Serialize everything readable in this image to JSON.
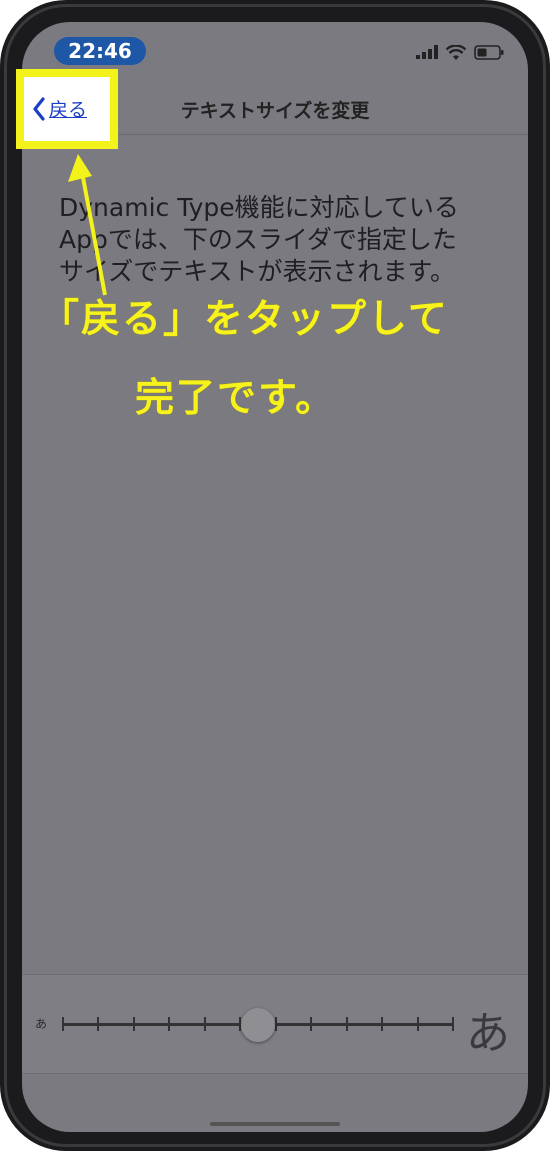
{
  "status_bar": {
    "time": "22:46",
    "icons": [
      "cellular-signal-icon",
      "wifi-icon",
      "battery-icon"
    ]
  },
  "nav": {
    "back_label": "戻る",
    "title": "テキストサイズを変更"
  },
  "content": {
    "description_lines": [
      "Dynamic Type機能に対応している",
      "Appでは、下のスライダで指定した",
      "サイズでテキストが表示されます。"
    ]
  },
  "annotation": {
    "caption_line1": "「戻る」をタップして",
    "caption_line2": "完了です。",
    "highlight_color": "#f4f21b"
  },
  "slider": {
    "min_label": "あ",
    "max_label": "あ",
    "tick_count": 12,
    "value_fraction": 0.5
  },
  "colors": {
    "screen_dim": "#7b7a80",
    "link_blue": "#1b3ec7",
    "time_pill": "#1f57a7"
  }
}
